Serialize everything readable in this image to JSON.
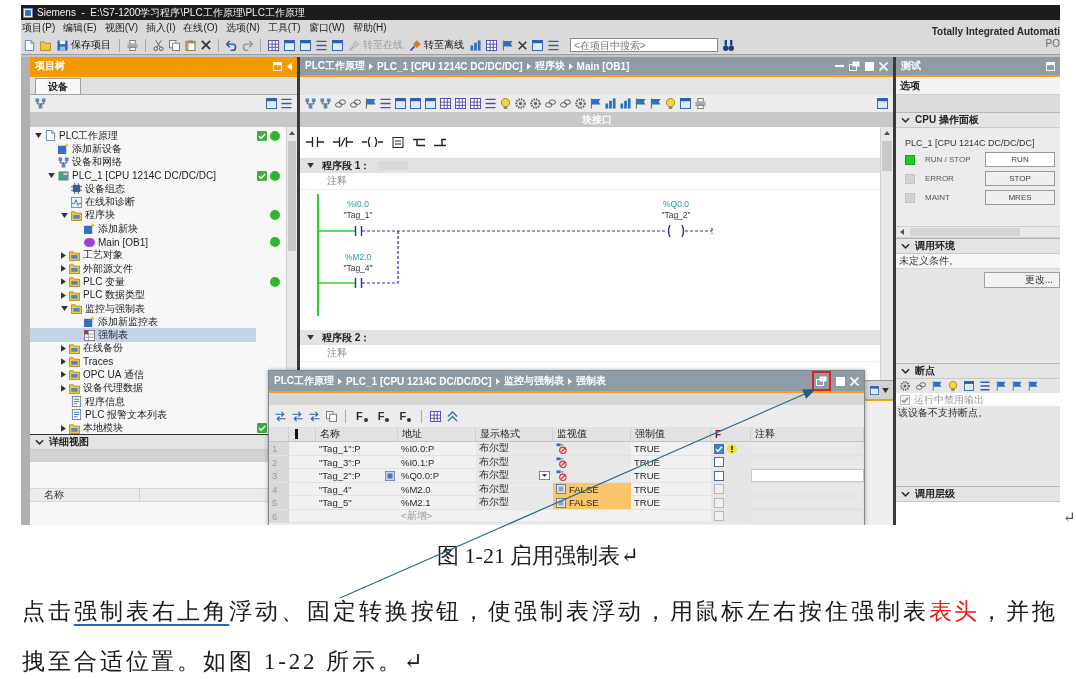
{
  "screenshot": {
    "title_bar": {
      "title": "Siemens  -  E:\\S7-1200学习程序\\PLC工作原理\\PLC工作原理"
    },
    "menu": [
      "项目(P)",
      "编辑(E)",
      "视图(V)",
      "插入(I)",
      "在线(O)",
      "选项(N)",
      "工具(T)",
      "窗口(W)",
      "帮助(H)"
    ],
    "brand": [
      "Totally Integrated Automati",
      "PO"
    ],
    "toolbar": {
      "buttons": [
        {
          "kind": "save",
          "label": "保存项目",
          "disabled": false
        },
        {
          "kind": "go-online",
          "label": "转至在线",
          "disabled": true
        },
        {
          "kind": "go-offline",
          "label": "转至离线",
          "disabled": false
        }
      ],
      "search": {
        "placeholder": "<在项目中搜索>"
      }
    },
    "project_tree": {
      "title": "项目树",
      "tabs": [
        {
          "label": "设备",
          "selected": true
        }
      ],
      "items": [
        {
          "label": "PLC工作原理",
          "kind": "project",
          "expanded": true,
          "selected": false,
          "compare_ok": true,
          "online": true,
          "children": [
            {
              "label": "添加新设备",
              "kind": "add",
              "selected": false,
              "compare_ok": false,
              "online": false
            },
            {
              "label": "设备和网络",
              "kind": "network",
              "selected": false,
              "compare_ok": false,
              "online": false
            },
            {
              "label": "PLC_1 [CPU 1214C DC/DC/DC]",
              "kind": "device",
              "expanded": true,
              "selected": false,
              "compare_ok": true,
              "online": true,
              "children": [
                {
                  "label": "设备组态",
                  "kind": "config",
                  "selected": false,
                  "compare_ok": false,
                  "online": false
                },
                {
                  "label": "在线和诊断",
                  "kind": "diagnostics",
                  "selected": false,
                  "compare_ok": false,
                  "online": false
                },
                {
                  "label": "程序块",
                  "kind": "folder",
                  "expanded": true,
                  "selected": false,
                  "compare_ok": false,
                  "online": true,
                  "children": [
                    {
                      "label": "添加新块",
                      "kind": "add",
                      "selected": false,
                      "compare_ok": false,
                      "online": false
                    },
                    {
                      "label": "Main [OB1]",
                      "kind": "block",
                      "selected": false,
                      "compare_ok": false,
                      "online": true
                    }
                  ]
                },
                {
                  "label": "工艺对象",
                  "kind": "folder",
                  "expanded": false,
                  "selected": false,
                  "compare_ok": false,
                  "online": false
                },
                {
                  "label": "外部源文件",
                  "kind": "folder",
                  "expanded": false,
                  "selected": false,
                  "compare_ok": false,
                  "online": false
                },
                {
                  "label": "PLC 变量",
                  "kind": "folder",
                  "expanded": false,
                  "selected": false,
                  "compare_ok": false,
                  "online": true
                },
                {
                  "label": "PLC 数据类型",
                  "kind": "folder",
                  "expanded": false,
                  "selected": false,
                  "compare_ok": false,
                  "online": false
                },
                {
                  "label": "监控与强制表",
                  "kind": "folder",
                  "expanded": true,
                  "selected": false,
                  "compare_ok": false,
                  "online": false,
                  "children": [
                    {
                      "label": "添加新监控表",
                      "kind": "add",
                      "selected": false,
                      "compare_ok": false,
                      "online": false
                    },
                    {
                      "label": "强制表",
                      "kind": "force-table",
                      "selected": true,
                      "compare_ok": false,
                      "online": false
                    }
                  ]
                },
                {
                  "label": "在线备份",
                  "kind": "folder",
                  "expanded": false,
                  "selected": false,
                  "compare_ok": false,
                  "online": false
                },
                {
                  "label": "Traces",
                  "kind": "folder",
                  "expanded": false,
                  "selected": false,
                  "compare_ok": false,
                  "online": false
                },
                {
                  "label": "OPC UA 通信",
                  "kind": "folder",
                  "expanded": false,
                  "selected": false,
                  "compare_ok": false,
                  "online": false
                },
                {
                  "label": "设备代理数据",
                  "kind": "folder",
                  "expanded": false,
                  "selected": false,
                  "compare_ok": false,
                  "online": false
                },
                {
                  "label": "程序信息",
                  "kind": "info",
                  "selected": false,
                  "compare_ok": false,
                  "online": false
                },
                {
                  "label": "PLC 报警文本列表",
                  "kind": "info",
                  "selected": false,
                  "compare_ok": false,
                  "online": false
                },
                {
                  "label": "本地模块",
                  "kind": "folder",
                  "expanded": false,
                  "selected": false,
                  "compare_ok": true,
                  "online": false
                }
              ]
            }
          ]
        }
      ],
      "detail_view": {
        "title": "详细视图",
        "expanded": true,
        "columns": [
          "名称"
        ]
      }
    },
    "editor": {
      "breadcrumb": [
        "PLC工作原理",
        "PLC_1 [CPU 1214C DC/DC/DC]",
        "程序块",
        "Main [OB1]"
      ],
      "interface_label": "块接口",
      "networks": [
        {
          "title": "程序段 1：",
          "comment": "注释",
          "expanded": true,
          "elements": [
            {
              "kind": "contact",
              "address": "%I0.0",
              "tag": "\"Tag_1\""
            },
            {
              "kind": "coil",
              "address": "%Q0.0",
              "tag": "\"Tag_2\""
            },
            {
              "kind": "parallel-contact",
              "address": "%M2.0",
              "tag": "\"Tag_4\""
            }
          ]
        },
        {
          "title": "程序段 2：",
          "comment": "注释",
          "expanded": true
        }
      ]
    },
    "task_card": {
      "title": "测试",
      "options_label": "选项",
      "sections": [
        {
          "kind": "cpu-panel",
          "title": "CPU 操作面板",
          "expanded": true,
          "device": "PLC_1 [CPU 1214C DC/DC/DC]",
          "leds": [
            {
              "label": "RUN / STOP",
              "lit": true
            },
            {
              "label": "ERROR",
              "lit": false
            },
            {
              "label": "MAINT",
              "lit": false
            }
          ],
          "buttons": [
            "RUN",
            "STOP",
            "MRES"
          ]
        },
        {
          "kind": "call-environment",
          "title": "调用环境",
          "expanded": true,
          "text": "未定义条件。",
          "button": "更改..."
        },
        {
          "kind": "breakpoints",
          "title": "断点",
          "expanded": true,
          "option": {
            "label": "运行中禁用输出",
            "checked": true,
            "disabled": true
          },
          "text": "该设备不支持断点。"
        },
        {
          "kind": "call-hierarchy",
          "title": "调用层级",
          "expanded": true
        }
      ]
    },
    "force_table": {
      "breadcrumb": [
        "PLC工作原理",
        "PLC_1 [CPU 1214C DC/DC/DC]",
        "监控与强制表",
        "强制表"
      ],
      "float_button": {
        "highlighted": true
      },
      "force_buttons": [
        "F",
        "F",
        "F"
      ],
      "columns": [
        "名称",
        "地址",
        "显示格式",
        "监视值",
        "强制值",
        "F",
        "注释"
      ],
      "rows": [
        {
          "number": "1",
          "name": "\"Tag_1\":P",
          "address": "%I0.0:P",
          "format": "布尔型",
          "monitor": {
            "kind": "no-connection"
          },
          "force_value": "TRUE",
          "force": true,
          "force_disabled": false,
          "warning": true,
          "selected": false
        },
        {
          "number": "2",
          "name": "\"Tag_3\":P",
          "address": "%I0.1:P",
          "format": "布尔型",
          "monitor": {
            "kind": "no-connection"
          },
          "force_value": "TRUE",
          "force": false,
          "force_disabled": false,
          "warning": false,
          "selected": false
        },
        {
          "number": "3",
          "name": "\"Tag_2\":P",
          "address": "%Q0.0:P",
          "format": "布尔型",
          "monitor": {
            "kind": "no-connection"
          },
          "force_value": "TRUE",
          "force": false,
          "force_disabled": false,
          "warning": false,
          "selected": true
        },
        {
          "number": "4",
          "name": "\"Tag_4\"",
          "address": "%M2.0",
          "format": "布尔型",
          "monitor": {
            "kind": "value",
            "text": "FALSE"
          },
          "force_value": "TRUE",
          "force": false,
          "force_disabled": true,
          "warning": false,
          "selected": false
        },
        {
          "number": "5",
          "name": "\"Tag_5\"",
          "address": "%M2.1",
          "format": "布尔型",
          "monitor": {
            "kind": "value",
            "text": "FALSE"
          },
          "force_value": "TRUE",
          "force": false,
          "force_disabled": true,
          "warning": false,
          "selected": false
        },
        {
          "number": "6",
          "placeholder": "<新增>",
          "force": false,
          "force_disabled": true,
          "warning": false,
          "selected": false
        }
      ]
    }
  },
  "image_paragraph_mark": "↵",
  "caption": "图 1-21 启用强制表↵",
  "paragraph": [
    {
      "kind": "plain",
      "text": "点击"
    },
    {
      "kind": "underlined",
      "text": "强制表右上角"
    },
    {
      "kind": "plain",
      "text": "浮动、固定转换按钮，使强制表浮动，用鼠标左右按住强制表"
    },
    {
      "kind": "highlight",
      "text": "表头"
    },
    {
      "kind": "plain",
      "text": "，并拖拽至合适位置。如图 1-22 所示。↵"
    }
  ]
}
